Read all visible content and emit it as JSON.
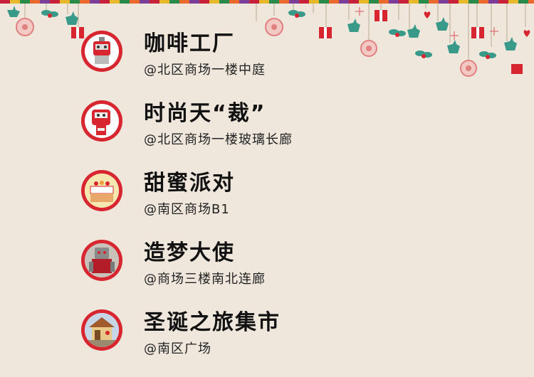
{
  "items": [
    {
      "title": "咖啡工厂",
      "location": "@北区商场一楼中庭",
      "icon": "robot-cup-icon"
    },
    {
      "title": "时尚天“裁”",
      "location": "@北区商场一楼玻璃长廊",
      "icon": "robot-tailor-icon"
    },
    {
      "title": "甜蜜派对",
      "location": "@南区商场B1",
      "icon": "cake-icon"
    },
    {
      "title": "造梦大使",
      "location": "@商场三楼南北连廊",
      "icon": "robot-figure-icon"
    },
    {
      "title": "圣诞之旅集市",
      "location": "@南区广场",
      "icon": "market-stall-icon"
    }
  ],
  "colors": {
    "background": "#efe7dc",
    "accent_red": "#d7262f",
    "ornament_teal": "#3a9a8a",
    "ornament_pink": "#e08080"
  }
}
